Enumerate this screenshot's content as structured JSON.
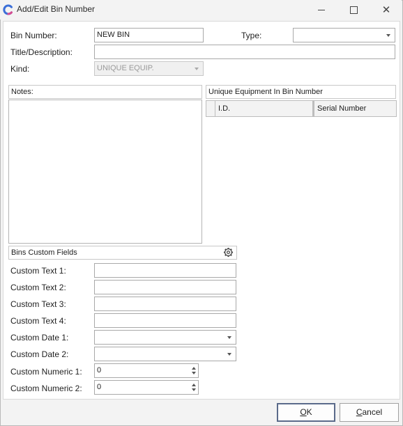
{
  "window": {
    "title": "Add/Edit Bin Number",
    "minimize_glyph": "—",
    "maximize_glyph": "☐",
    "close_glyph": "✕"
  },
  "form": {
    "bin_number_label": "Bin Number:",
    "bin_number_value": "NEW BIN",
    "type_label": "Type:",
    "type_value": "",
    "title_label": "Title/Description:",
    "title_value": "",
    "kind_label": "Kind:",
    "kind_value": "UNIQUE EQUIP."
  },
  "notes": {
    "header": "Notes:",
    "value": ""
  },
  "equipment": {
    "header": "Unique Equipment In Bin Number",
    "columns": [
      "I.D.",
      "Serial Number"
    ]
  },
  "custom": {
    "header": "Bins Custom Fields",
    "text1_label": "Custom Text 1:",
    "text2_label": "Custom Text 2:",
    "text3_label": "Custom Text 3:",
    "text4_label": "Custom Text 4:",
    "date1_label": "Custom Date 1:",
    "date2_label": "Custom Date 2:",
    "numeric1_label": "Custom Numeric 1:",
    "numeric1_value": "0",
    "numeric2_label": "Custom Numeric 2:",
    "numeric2_value": "0"
  },
  "buttons": {
    "ok_u": "O",
    "ok_rest": "K",
    "cancel_u": "C",
    "cancel_rest": "ancel"
  },
  "icons": {
    "app": "app-logo-icon",
    "settings": "gear-icon"
  },
  "colors": {
    "logo_blue": "#3b6fd8",
    "logo_pink": "#d84b8f"
  }
}
